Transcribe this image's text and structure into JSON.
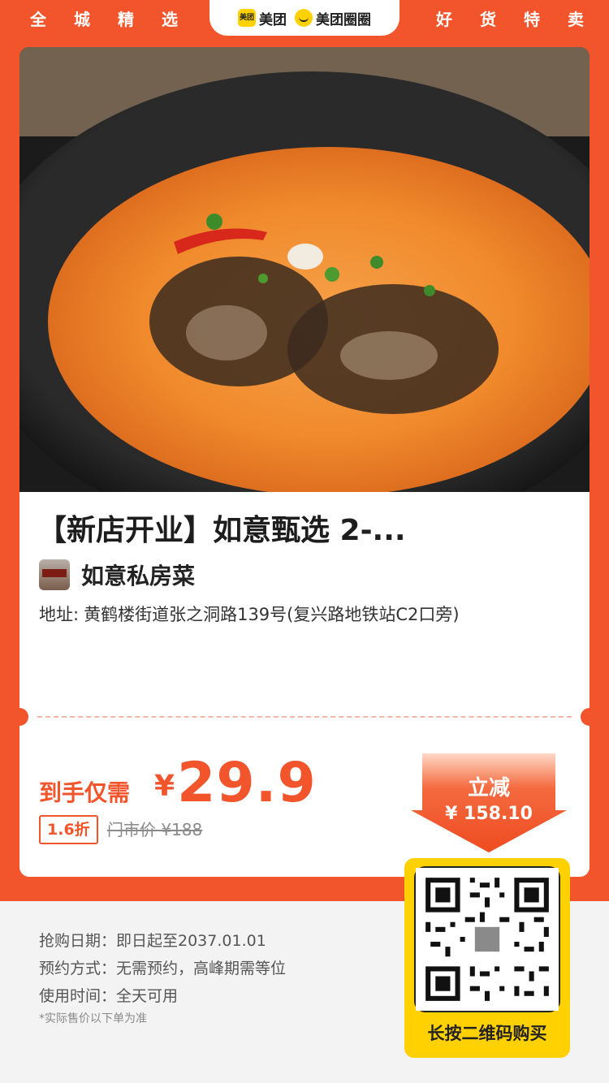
{
  "header": {
    "left_chars": [
      "全",
      "城",
      "精",
      "选"
    ],
    "right_chars": [
      "好",
      "货",
      "特",
      "卖"
    ],
    "brand": [
      {
        "mark": "美团",
        "text": "美团"
      },
      {
        "text": "美团圈圈"
      }
    ]
  },
  "product": {
    "title": "【新店开业】如意甄选 2-...",
    "shop_name": "如意私房菜",
    "address_label": "地址:",
    "address": "黄鹤楼街道张之洞路139号(复兴路地铁站C2口旁)"
  },
  "price": {
    "label": "到手仅需",
    "currency": "¥",
    "value": "29.9",
    "discount": "1.6折",
    "market_price": "门市价 ¥188"
  },
  "badge": {
    "title": "立减",
    "amount": "¥ 158.10"
  },
  "info": {
    "purchase_date": "抢购日期：即日起至2037.01.01",
    "reservation": "预约方式：无需预约，高峰期需等位",
    "usage_time": "使用时间：全天可用",
    "note": "*实际售价以下单为准"
  },
  "qr": {
    "caption": "长按二维码购买"
  },
  "colors": {
    "accent": "#f2542b",
    "brand_yellow": "#ffd100"
  }
}
